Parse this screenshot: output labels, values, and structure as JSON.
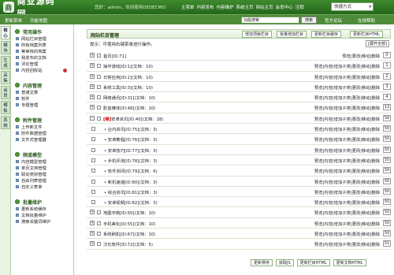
{
  "brand": {
    "mark": "商",
    "name": "商业源码网"
  },
  "header": {
    "welcome": "您好：admin，欢迎使用DEDECMS！",
    "nav": [
      "主菜单",
      "内容发布",
      "内容维护",
      "系统主页",
      "网站主页",
      "会员中心",
      "注销"
    ],
    "quick_menu": "快捷方式"
  },
  "toolbar": {
    "update_cache": "更新菜单",
    "feature_map": "功能地图",
    "search_value": "功能搜索",
    "search_btn": "搜索",
    "official_forum": "官方论坛",
    "online_help": "在线帮助"
  },
  "vtabs": [
    "核心",
    "模块",
    "生成",
    "采集",
    "会员",
    "模板",
    "系统"
  ],
  "sidebar": [
    {
      "title": "常用操作",
      "items": [
        "网站栏目管理",
        "所有档案列表",
        "等审核的档案",
        "我发布的文档",
        "评论管理",
        "内容回收站"
      ]
    },
    {
      "title": "内容管理",
      "items": [
        "普通文章",
        "软件",
        "专题管理"
      ]
    },
    {
      "title": "附件管理",
      "items": [
        "上传新文件",
        "附件数据管理",
        "文件式管理器"
      ]
    },
    {
      "title": "频道模型",
      "items": [
        "内容模型管理",
        "单页文档管理",
        "联动类别管理",
        "自由列表管理",
        "自定义表单"
      ]
    },
    {
      "title": "批量维护",
      "items": [
        "更新系统缓存",
        "文档批量维护",
        "搜索关键词维护"
      ]
    }
  ],
  "main": {
    "title": "网站栏目管理",
    "buttons": [
      "增加顶级栏目",
      "批量增加栏目",
      "更新栏目缓存",
      "更新栏目HTML"
    ],
    "hint": "提示：可使用右键菜单进行操作。",
    "expand_all": "[展开全部]",
    "rows": [
      {
        "pm": "+",
        "name": "首页[ID:71]",
        "ops": "预览|更改|移动|删除",
        "sort": "0",
        "tag": "",
        "child": false
      },
      {
        "pm": "+",
        "name": "操作游戏[ID:1](文档：10)",
        "ops": "预览|内容|增加子类|更改|移动|删除",
        "sort": "1",
        "tag": "",
        "child": false
      },
      {
        "pm": "+",
        "name": "日常应用[ID:2](文档：10)",
        "ops": "预览|内容|增加子类|更改|移动|删除",
        "sort": "2",
        "tag": "",
        "child": false
      },
      {
        "pm": "+",
        "name": "系统工具[ID:3](文档：10)",
        "ops": "预览|内容|增加子类|更改|移动|删除",
        "sort": "3",
        "tag": "",
        "child": false
      },
      {
        "pm": "+",
        "name": "网络通讯[ID:31](文档：10)",
        "ops": "预览|内容|增加子类|更改|移动|删除",
        "sort": "4",
        "tag": "",
        "child": false
      },
      {
        "pm": "+",
        "name": "影音媒体[ID:48](文档：10)",
        "ops": "预览|内容|增加子类|更改|移动|删除",
        "sort": "12",
        "tag": "",
        "child": false
      },
      {
        "pm": "−",
        "name": "安卓资讯[ID:40](文档：28)",
        "ops": "预览|内容|增加子类|更改|移动|删除",
        "sort": "50",
        "tag": "[频]",
        "child": false
      },
      {
        "pm": "",
        "name": "• 业内资讯[ID:75](文档：3)",
        "ops": "预览|内容|增加子类|更改|移动|删除",
        "sort": "50",
        "tag": "",
        "child": true
      },
      {
        "pm": "",
        "name": "• 安卓教程[ID:76](文档：3)",
        "ops": "预览|内容|增加子类|更改|移动|删除",
        "sort": "50",
        "tag": "",
        "child": true
      },
      {
        "pm": "",
        "name": "• 安卓技巧[ID:77](文档：3)",
        "ops": "预览|内容|增加子类|更改|移动|删除",
        "sort": "50",
        "tag": "",
        "child": true
      },
      {
        "pm": "",
        "name": "• 手机评测[ID:78](文档：3)",
        "ops": "预览|内容|增加子类|更改|移动|删除",
        "sort": "50",
        "tag": "",
        "child": true
      },
      {
        "pm": "",
        "name": "• 软件测评[ID:79](文档：6)",
        "ops": "预览|内容|增加子类|更改|移动|删除",
        "sort": "50",
        "tag": "",
        "child": true
      },
      {
        "pm": "",
        "name": "• 新机速递[ID:80](文档：3)",
        "ops": "预览|内容|增加子类|更改|移动|删除",
        "sort": "50",
        "tag": "",
        "child": true
      },
      {
        "pm": "",
        "name": "• 综合资讯[ID:81](文档：3)",
        "ops": "预览|内容|增加子类|更改|移动|删除",
        "sort": "50",
        "tag": "",
        "child": true
      },
      {
        "pm": "",
        "name": "• 安卓视频[ID:82](文档：3)",
        "ops": "预览|内容|增加子类|更改|移动|删除",
        "sort": "50",
        "tag": "",
        "child": true
      },
      {
        "pm": "+",
        "name": "地图字典[ID:50](文档：10)",
        "ops": "预览|内容|增加子类|更改|移动|删除",
        "sort": "50",
        "tag": "",
        "child": false
      },
      {
        "pm": "+",
        "name": "手机美化[ID:55](文档：10)",
        "ops": "预览|内容|增加子类|更改|移动|删除",
        "sort": "50",
        "tag": "",
        "child": false
      },
      {
        "pm": "+",
        "name": "系统刷机[ID:67](文档：10)",
        "ops": "预览|内容|增加子类|更改|移动|删除",
        "sort": "50",
        "tag": "",
        "child": false
      },
      {
        "pm": "+",
        "name": "汉化软件[ID:72](文档：5)",
        "ops": "预览|内容|增加子类|更改|移动|删除",
        "sort": "51",
        "tag": "",
        "child": false
      }
    ],
    "footer": [
      "更新排序",
      "获取JS",
      "更新栏目HTML",
      "更新文档HTML"
    ]
  }
}
